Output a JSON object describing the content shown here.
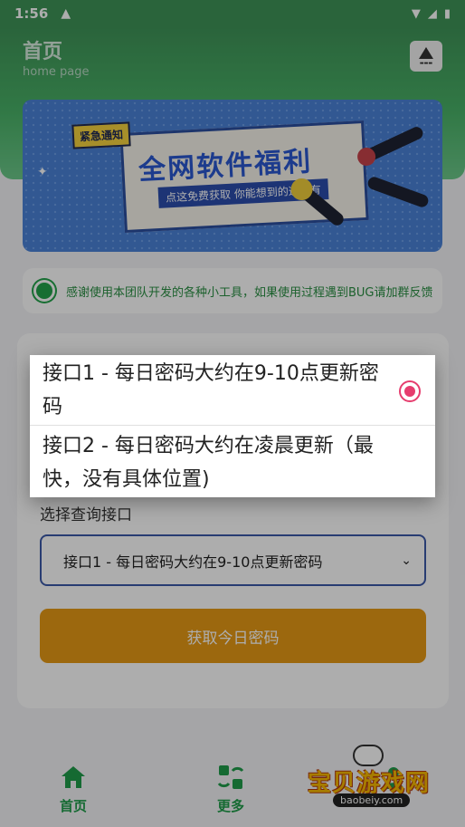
{
  "status_bar": {
    "time": "1:56"
  },
  "header": {
    "title": "首页",
    "subtitle": "home page"
  },
  "banner": {
    "tag": "紧急通知",
    "headline": "全网软件福利",
    "strip": "点这免费获取 你能想到的这都有"
  },
  "notice": {
    "text": "感谢使用本团队开发的各种小工具，如果使用过程遇到BUG请加群反馈"
  },
  "form": {
    "label": "选择查询接口",
    "selected": "接口1 - 每日密码大约在9-10点更新密码",
    "button": "获取今日密码"
  },
  "dialog": {
    "options": [
      {
        "label": "接口1 - 每日密码大约在9-10点更新密码",
        "selected": true
      },
      {
        "label": "接口2 - 每日密码大约在凌晨更新（最快，没有具体位置)",
        "selected": false
      }
    ]
  },
  "bottom_nav": {
    "items": [
      {
        "label": "首页",
        "icon": "home-icon"
      },
      {
        "label": "更多",
        "icon": "apps-icon"
      },
      {
        "label": "",
        "icon": "profile-icon"
      }
    ]
  },
  "watermark": {
    "brand": "宝贝游戏网",
    "url": "baobeiy.com"
  },
  "colors": {
    "primary_green": "#3f9458",
    "accent_orange": "#e69a16",
    "radio_pink": "#e63d6e"
  }
}
